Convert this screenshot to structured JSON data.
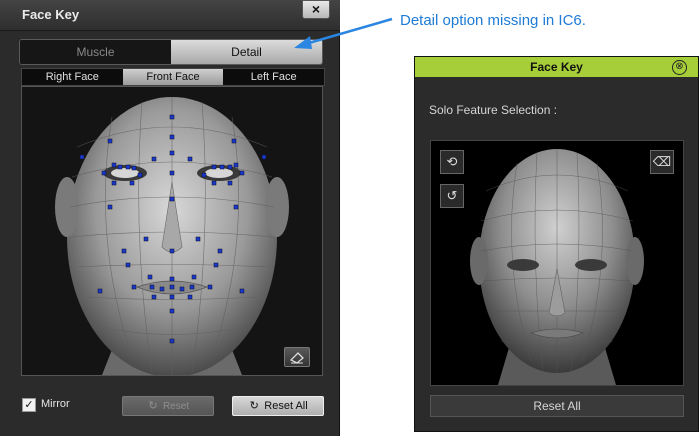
{
  "left_panel": {
    "title": "Face Key",
    "close_label": "×",
    "mode_tabs": [
      {
        "label": "Muscle"
      },
      {
        "label": "Detail"
      }
    ],
    "view_tabs": [
      {
        "label": "Right Face"
      },
      {
        "label": "Front Face"
      },
      {
        "label": "Left Face"
      }
    ],
    "mirror_label": "Mirror",
    "mirror_checked_mark": "✓",
    "reset_label": "Reset",
    "reset_all_label": "Reset All",
    "reset_icon": "↻",
    "active_tab_color": "#a9a9a9",
    "control_point_color": "#1a37c9",
    "icons": {
      "eraser": "eraser-icon",
      "reset": "refresh-icon"
    }
  },
  "annotation": {
    "text": "Detail option missing in IC6.",
    "color": "#1e7bd6"
  },
  "right_panel": {
    "title": "Face Key",
    "close_label": "⊗",
    "title_bar_color": "#a6ce39",
    "solo_label": "Solo Feature Selection :",
    "rotate_icon_glyph": "⟲",
    "undo_icon_glyph": "↺",
    "eraser_icon_glyph": "⌫",
    "reset_all_label": "Reset All"
  }
}
